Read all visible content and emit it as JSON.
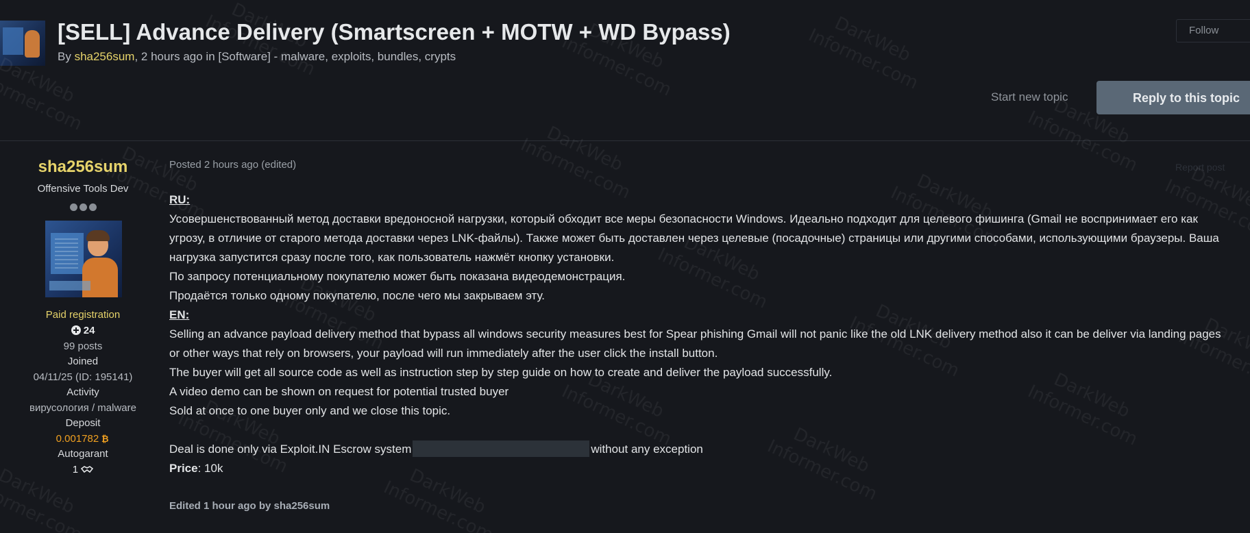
{
  "topic": {
    "title": "[SELL] Advance Delivery (Smartscreen + MOTW + WD Bypass)",
    "meta_by": "By ",
    "meta_author": "sha256sum",
    "meta_rest": ", 2 hours ago in [Software] - malware, exploits, bundles, crypts",
    "follow_label": "Follow",
    "start_topic_label": "Start new topic",
    "reply_label": "Reply to this topic"
  },
  "author": {
    "name": "sha256sum",
    "title": "Offensive Tools Dev",
    "group": "Paid registration",
    "reputation": "24",
    "posts": "99 posts",
    "joined_label": "Joined",
    "joined_value": "04/11/25 (ID: 195141)",
    "activity_label": "Activity",
    "activity_value": "вирусология / malware",
    "deposit_label": "Deposit",
    "deposit_value": "0.001782",
    "autogarant_label": "Autogarant",
    "autogarant_value": "1"
  },
  "post": {
    "posted": "Posted 2 hours ago (edited)",
    "report": "Report post",
    "ru_heading": "RU:",
    "ru_lines": [
      "Усовершенствованный метод доставки вредоносной нагрузки, который обходит все меры безопасности Windows. Идеально подходит для целевого фишинга (Gmail не воспринимает его как",
      "угрозу, в отличие от старого метода доставки через LNK-файлы). Также может быть доставлен через целевые (посадочные) страницы или другими способами, использующими браузеры. Ваша",
      "нагрузка запустится сразу после того, как пользователь нажмёт кнопку установки.",
      "По запросу потенциальному покупателю может быть показана видеодемонстрация.",
      "Продаётся только одному покупателю, после чего мы закрываем эту."
    ],
    "en_heading": "EN:",
    "en_lines": [
      "Selling an advance payload delivery method that bypass all windows security measures best for Spear phishing Gmail will not panic like the old LNK delivery method also it can be deliver via landing pages",
      "or other ways that rely on browsers, your payload will run immediately after the user click the install button.",
      "The buyer will get all source code as well as instruction step by step guide on how to create and deliver the payload successfully.",
      "A video demo can be shown on request for potential trusted buyer",
      "Sold at once to one buyer only and we close this topic."
    ],
    "deal_before": "Deal is done only via Exploit.IN Escrow system",
    "deal_after": "without any exception",
    "price_label": "Price",
    "price_value": ": 10k",
    "edited": "Edited 1 hour ago by sha256sum"
  },
  "watermark": [
    "DarkWeb",
    "Informer.com"
  ],
  "icons": {
    "reputation": "plus-circle-icon",
    "deposit": "bitcoin-icon",
    "autogarant": "handshake-icon"
  },
  "colors": {
    "background": "#16181d",
    "author_yellow": "#e6d36a",
    "deposit_orange": "#f0a020",
    "reply_button": "#5a6876"
  }
}
